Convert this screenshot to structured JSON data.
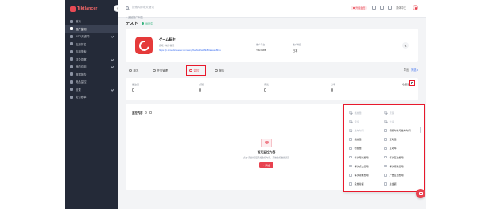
{
  "brand": {
    "name": "Tiktlancer"
  },
  "sidebar": {
    "items": [
      {
        "label": "首页",
        "icon": "home-icon",
        "active": false,
        "has_children": false
      },
      {
        "label": "推广监测",
        "icon": "monitor-icon",
        "active": true,
        "has_children": false
      },
      {
        "label": "ASO关键词",
        "icon": "keyword-icon",
        "active": false,
        "has_children": true
      },
      {
        "label": "应用排名",
        "icon": "rank-icon",
        "active": false,
        "has_children": false
      },
      {
        "label": "应用搜索",
        "icon": "search-icon",
        "active": false,
        "has_children": false
      },
      {
        "label": "评论洞察",
        "icon": "comment-icon",
        "active": false,
        "has_children": true
      },
      {
        "label": "我的应用",
        "icon": "app-icon",
        "active": false,
        "has_children": true
      },
      {
        "label": "数据报告",
        "icon": "report-icon",
        "active": false,
        "has_children": false
      },
      {
        "label": "竞品监控",
        "icon": "compete-icon",
        "active": false,
        "has_children": false
      },
      {
        "label": "设置",
        "icon": "gear-icon",
        "active": false,
        "has_children": true
      },
      {
        "label": "支付账单",
        "icon": "bill-icon",
        "active": false,
        "has_children": false
      }
    ]
  },
  "header": {
    "search_placeholder": "搜索App或关键词",
    "promo": "升级会员",
    "lang": "简体中文"
  },
  "page": {
    "breadcrumb": "< 返回推广列表",
    "title": "テスト",
    "status": "运行中"
  },
  "app": {
    "name": "ゲーム転生",
    "meta": "游戏 · 动作冒险",
    "link": "https://p.mmeclickeener.com/feng/ibe/6sfdfafdf9s80aiasas8hss",
    "kv": [
      {
        "k": "推广平台",
        "v": "YouTube"
      },
      {
        "k": "推广地区",
        "v": "日本"
      }
    ]
  },
  "tabs": [
    {
      "label": "概况",
      "active": false
    },
    {
      "label": "任务管理",
      "active": false
    },
    {
      "label": "监控",
      "active": true
    },
    {
      "label": "报告",
      "active": false
    }
  ],
  "tabs_right": {
    "label": "导出",
    "extra": "筛选 ▾"
  },
  "stats": [
    {
      "k": "播放量",
      "v": "0"
    },
    {
      "k": "点赞",
      "v": "0"
    },
    {
      "k": "评论",
      "v": "0"
    },
    {
      "k": "分享",
      "v": "0"
    },
    {
      "k": "收藏量",
      "v": ""
    }
  ],
  "content": {
    "title": "监控内容",
    "empty_title": "暂无监控内容",
    "empty_desc": "点击“添加”按钮添加监控内容，开始监控数据表现",
    "empty_btn": "+ 添加"
  },
  "dropdown": {
    "items": [
      {
        "label": "播放量",
        "disabled": true,
        "checked": true
      },
      {
        "label": "点赞",
        "disabled": true,
        "checked": true
      },
      {
        "label": "评论",
        "disabled": true,
        "checked": true
      },
      {
        "label": "分享",
        "disabled": true,
        "checked": true
      },
      {
        "label": "发布时间",
        "disabled": true,
        "checked": true
      },
      {
        "label": "视频时长与发布时间",
        "disabled": false,
        "checked": false
      },
      {
        "label": "播放量",
        "disabled": false,
        "checked": false
      },
      {
        "label": "互动量",
        "disabled": false,
        "checked": false
      },
      {
        "label": "粉丝量",
        "disabled": false,
        "checked": false
      },
      {
        "label": "互动率",
        "disabled": false,
        "checked": false
      },
      {
        "label": "千次曝光费用",
        "disabled": false,
        "checked": false
      },
      {
        "label": "每次互动费用",
        "disabled": false,
        "checked": false
      },
      {
        "label": "每次点击费用",
        "disabled": false,
        "checked": false
      },
      {
        "label": "每次观看费用",
        "disabled": false,
        "checked": false
      },
      {
        "label": "每次观看费用",
        "disabled": false,
        "checked": false
      },
      {
        "label": "广告互动费用",
        "disabled": false,
        "checked": false
      },
      {
        "label": "投放总额",
        "disabled": false,
        "checked": false
      },
      {
        "label": "总金额",
        "disabled": false,
        "checked": false
      }
    ]
  }
}
